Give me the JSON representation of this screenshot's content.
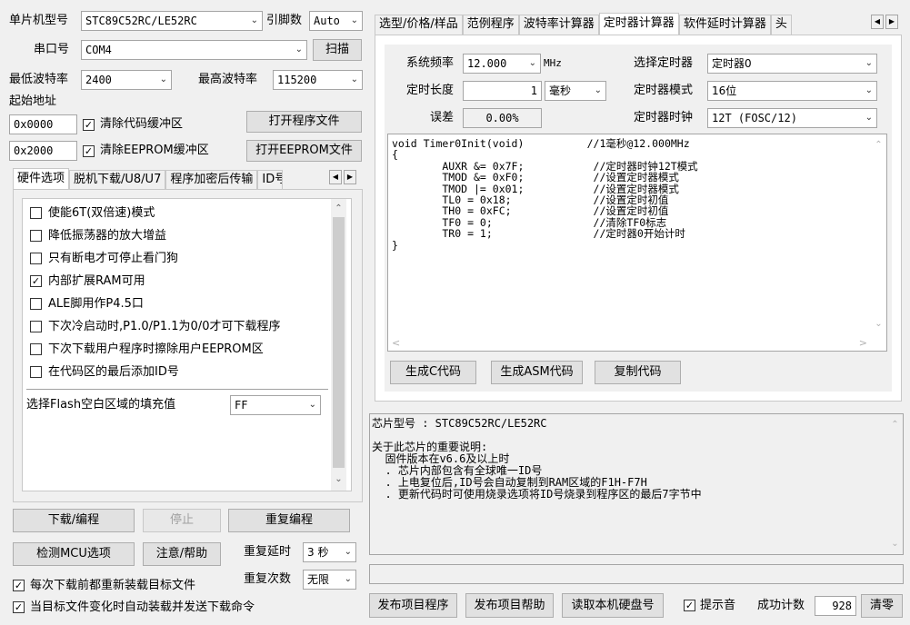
{
  "top": {
    "mcu_label": "单片机型号",
    "mcu_value": "STC89C52RC/LE52RC",
    "pins_label": "引脚数",
    "pins_value": "Auto",
    "port_label": "串口号",
    "port_value": "COM4",
    "scan_button": "扫描",
    "min_baud_label": "最低波特率",
    "min_baud_value": "2400",
    "max_baud_label": "最高波特率",
    "max_baud_value": "115200",
    "start_addr_label": "起始地址",
    "addr1_value": "0x0000",
    "clear_code_label": "清除代码缓冲区",
    "open_program_button": "打开程序文件",
    "addr2_value": "0x2000",
    "clear_eeprom_label": "清除EEPROM缓冲区",
    "open_eeprom_button": "打开EEPROM文件"
  },
  "left_tabs": [
    "硬件选项",
    "脱机下载/U8/U7",
    "程序加密后传输",
    "ID号"
  ],
  "hw_options": [
    {
      "label": "使能6T(双倍速)模式",
      "checked": false
    },
    {
      "label": "降低振荡器的放大增益",
      "checked": false
    },
    {
      "label": "只有断电才可停止看门狗",
      "checked": false
    },
    {
      "label": "内部扩展RAM可用",
      "checked": true
    },
    {
      "label": "ALE脚用作P4.5口",
      "checked": false
    },
    {
      "label": "下次冷启动时,P1.0/P1.1为0/0才可下载程序",
      "checked": false
    },
    {
      "label": "下次下载用户程序时擦除用户EEPROM区",
      "checked": false
    },
    {
      "label": "在代码区的最后添加ID号",
      "checked": false
    }
  ],
  "fill_label": "选择Flash空白区域的填充值",
  "fill_value": "FF",
  "bottom_left": {
    "download_button": "下载/编程",
    "stop_button": "停止",
    "reprogram_button": "重复编程",
    "detect_button": "检测MCU选项",
    "help_button": "注意/帮助",
    "repeat_delay_label": "重复延时",
    "repeat_delay_value": "3 秒",
    "repeat_count_label": "重复次数",
    "repeat_count_value": "无限",
    "reload_label": "每次下载前都重新装载目标文件",
    "auto_load_label": "当目标文件变化时自动装载并发送下载命令"
  },
  "right_tabs": [
    "选型/价格/样品",
    "范例程序",
    "波特率计算器",
    "定时器计算器",
    "软件延时计算器",
    "头"
  ],
  "timer": {
    "sysclk_label": "系统频率",
    "sysclk_value": "12.000",
    "sysclk_unit": "MHz",
    "select_timer_label": "选择定时器",
    "select_timer_value": "定时器0",
    "length_label": "定时长度",
    "length_value": "1",
    "length_unit": "毫秒",
    "mode_label": "定时器模式",
    "mode_value": "16位",
    "error_label": "误差",
    "error_value": "0.00%",
    "clock_label": "定时器时钟",
    "clock_value": "12T (FOSC/12)",
    "code": "void Timer0Init(void)          //1毫秒@12.000MHz\n{\n        AUXR &= 0x7F;           //定时器时钟12T模式\n        TMOD &= 0xF0;           //设置定时器模式\n        TMOD |= 0x01;           //设置定时器模式\n        TL0 = 0x18;             //设置定时初值\n        TH0 = 0xFC;             //设置定时初值\n        TF0 = 0;                //清除TF0标志\n        TR0 = 1;                //定时器0开始计时\n}",
    "gen_c_button": "生成C代码",
    "gen_asm_button": "生成ASM代码",
    "copy_button": "复制代码"
  },
  "info_text": "芯片型号 : STC89C52RC/LE52RC\n\n关于此芯片的重要说明:\n  固件版本在v6.6及以上时\n  . 芯片内部包含有全球唯一ID号\n  . 上电复位后,ID号会自动复制到RAM区域的F1H-F7H\n  . 更新代码时可使用烧录选项将ID号烧录到程序区的最后7字节中",
  "bottom_right": {
    "publish_program_button": "发布项目程序",
    "publish_help_button": "发布项目帮助",
    "read_disk_button": "读取本机硬盘号",
    "sound_label": "提示音",
    "success_label": "成功计数",
    "success_value": "928",
    "clear_button": "清零"
  }
}
